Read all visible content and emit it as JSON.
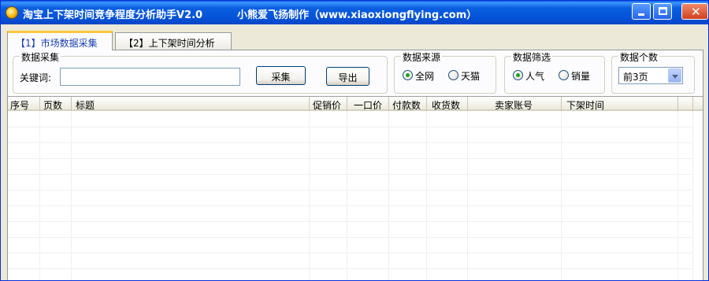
{
  "window": {
    "title": "淘宝上下架时间竞争程度分析助手V2.0",
    "subtitle": "小熊爱飞扬制作（www.xiaoxiongflying.com）",
    "icon": "app-icon"
  },
  "tabs": [
    {
      "label": "【1】市场数据采集",
      "active": true
    },
    {
      "label": "【2】上下架时间分析",
      "active": false
    }
  ],
  "collect": {
    "legend": "数据采集",
    "keyword_label": "关键词:",
    "keyword_value": "",
    "collect_button": "采集",
    "export_button": "导出"
  },
  "source": {
    "legend": "数据来源",
    "options": [
      "全网",
      "天猫"
    ],
    "selected": "全网"
  },
  "filter": {
    "legend": "数据筛选",
    "options": [
      "人气",
      "销量"
    ],
    "selected": "人气"
  },
  "count": {
    "legend": "数据个数",
    "selected": "前3页"
  },
  "table": {
    "columns": [
      "序号",
      "页数",
      "标题",
      "促销价",
      "一口价",
      "付款数",
      "收货数",
      "卖家账号",
      "下架时间"
    ],
    "rows": []
  }
}
